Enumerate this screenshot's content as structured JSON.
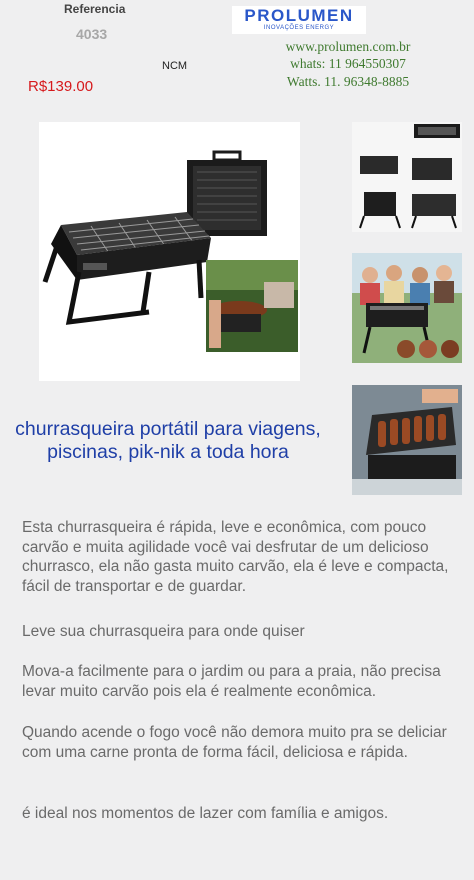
{
  "header": {
    "reference_label": "Referencia",
    "reference_code": "4033",
    "ncm_label": "NCM",
    "price": "R$139.00"
  },
  "brand": {
    "name": "PROLUMEN",
    "tagline": "INOVAÇÕES ENERGY",
    "color": "#2a57c9"
  },
  "contact": {
    "website": "www.prolumen.com.br",
    "whatsapp": "whats: 11 964550307",
    "phone": "Watts. 11. 96348-8885"
  },
  "product": {
    "title_lines": [
      "churrasqueira portátil para viagens,",
      "piscinas, pik-nik a toda hora"
    ],
    "paragraphs": [
      "Esta churrasqueira é rápida, leve e econômica, com pouco carvão e muita agilidade você vai desfrutar de um delicioso churrasco, ela não gasta muito carvão, ela é leve e compacta, fácil de transportar e de guardar.",
      "Leve sua churrasqueira para onde quiser",
      "Mova-a facilmente para o jardim ou para a praia, não precisa levar muito carvão pois ela é realmente econômica.",
      "Quando acende o fogo você não demora muito pra se deliciar com uma carne pronta de forma fácil, deliciosa e rápida.",
      "é ideal nos momentos de lazer com família e amigos."
    ]
  },
  "colors": {
    "price": "#d6191c",
    "title": "#1f3fa7",
    "contact": "#3f7a2f",
    "body_text": "#6a6a6a"
  }
}
